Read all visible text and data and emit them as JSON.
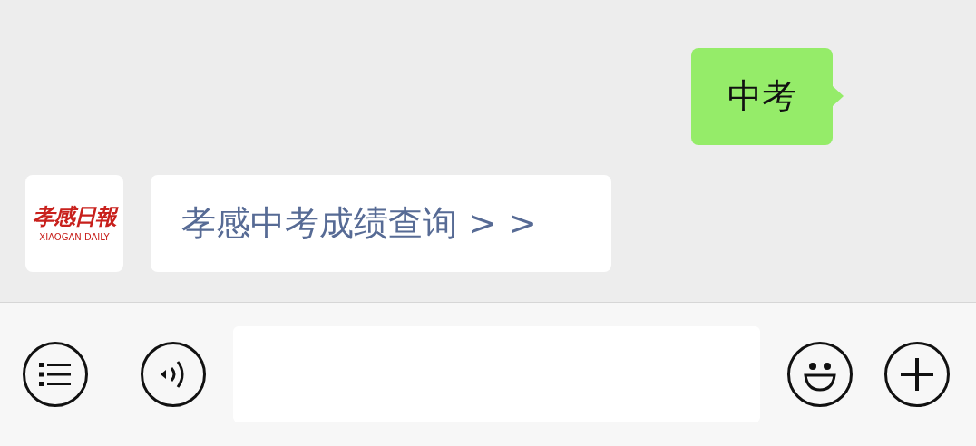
{
  "messages": [
    {
      "kind": "sent",
      "text": "中考"
    },
    {
      "kind": "received",
      "text": "孝感中考成绩查询 > >",
      "avatar": {
        "title": "孝感日報",
        "subtitle": "XIAOGAN DAILY"
      }
    }
  ]
}
